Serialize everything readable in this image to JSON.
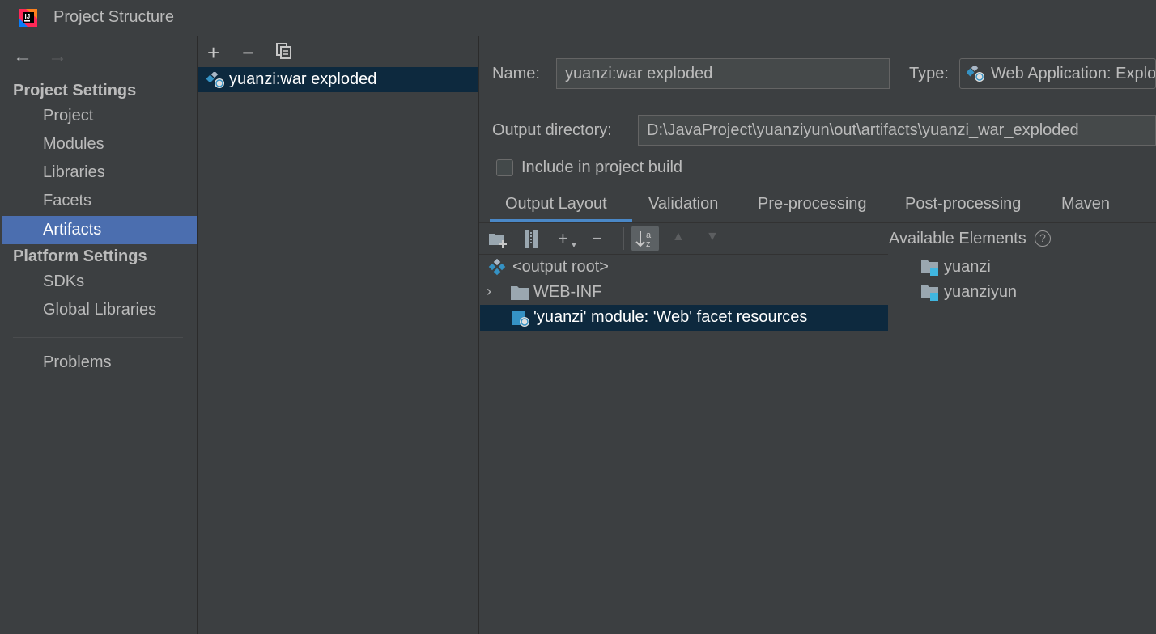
{
  "window": {
    "title": "Project Structure"
  },
  "nav": {
    "back_icon": "arrow-left-icon",
    "forward_icon": "arrow-right-icon",
    "project_settings_header": "Project Settings",
    "project_items": [
      "Project",
      "Modules",
      "Libraries",
      "Facets",
      "Artifacts"
    ],
    "selected": "Artifacts",
    "platform_settings_header": "Platform Settings",
    "platform_items": [
      "SDKs",
      "Global Libraries"
    ],
    "problems": "Problems"
  },
  "artifacts_list": {
    "toolbar": {
      "add": "+",
      "remove": "−",
      "copy_icon": "copy-icon"
    },
    "items": [
      "yuanzi:war exploded"
    ]
  },
  "artifact": {
    "name_label": "Name:",
    "name_value": "yuanzi:war exploded",
    "type_label": "Type:",
    "type_value": "Web Application: Exploded",
    "output_dir_label": "Output directory:",
    "output_dir_value": "D:\\JavaProject\\yuanziyun\\out\\artifacts\\yuanzi_war_exploded",
    "include_in_build_label": "Include in project build",
    "include_in_build_checked": false
  },
  "tabs": [
    "Output Layout",
    "Validation",
    "Pre-processing",
    "Post-processing",
    "Maven"
  ],
  "active_tab": "Output Layout",
  "layout_toolbar": {
    "add": "+",
    "remove": "−"
  },
  "output_tree": {
    "root": "<output root>",
    "web_inf": "WEB-INF",
    "facet_resources": "'yuanzi' module: 'Web' facet resources"
  },
  "available_elements": {
    "title": "Available Elements",
    "help": "?",
    "items": [
      "yuanzi",
      "yuanziyun"
    ]
  },
  "colors": {
    "background": "#3c3f41",
    "selection": "#4b6eaf",
    "tree_selection": "#0d293e",
    "tab_underline": "#4a88c7"
  }
}
